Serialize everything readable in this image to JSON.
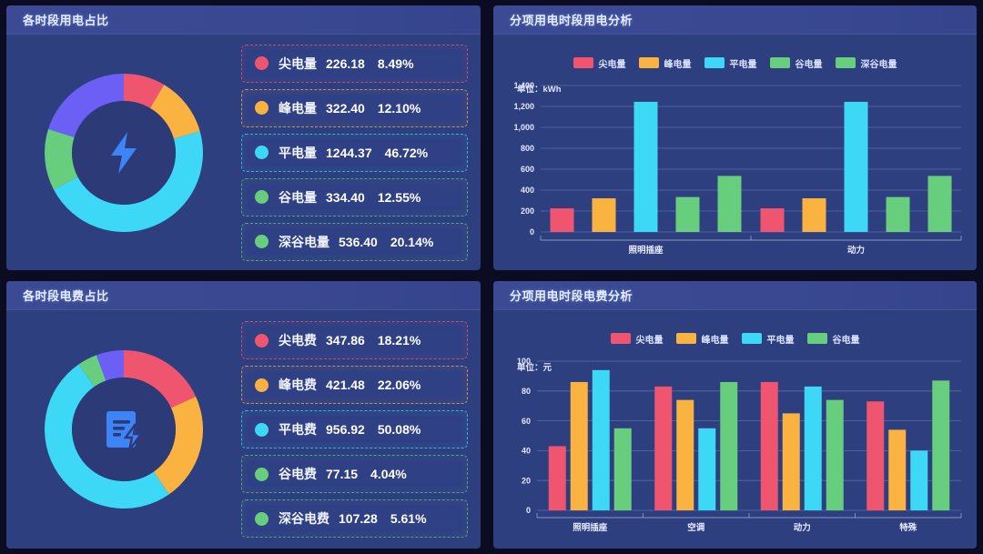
{
  "theme": {
    "background": "#0b0c22",
    "panel_bg": "#2e3f80",
    "header_bg": "#3a4991",
    "title_color": "#e8ecff"
  },
  "series_colors": {
    "jian": "#f0556f",
    "feng": "#fab240",
    "ping": "#3cd8f5",
    "gu": "#66ce7c",
    "shengu": "#6c5ff6",
    "shengu_legend": "#66ce7c"
  },
  "panels": {
    "usage_share": {
      "title": "各时段用电占比",
      "center_icon": "lightning-bolt-icon",
      "legend": [
        {
          "name": "尖电量",
          "value": "226.18",
          "percent": "8.49%",
          "pct_num": 8.49,
          "color": "#f0556f",
          "dot": "#f0556f"
        },
        {
          "name": "峰电量",
          "value": "322.40",
          "percent": "12.10%",
          "pct_num": 12.1,
          "color": "#fab240",
          "dot": "#fab240"
        },
        {
          "name": "平电量",
          "value": "1244.37",
          "percent": "46.72%",
          "pct_num": 46.72,
          "color": "#3cd8f5",
          "dot": "#3cd8f5"
        },
        {
          "name": "谷电量",
          "value": "334.40",
          "percent": "12.55%",
          "pct_num": 12.55,
          "color": "#66ce7c",
          "dot": "#66ce7c"
        },
        {
          "name": "深谷电量",
          "value": "536.40",
          "percent": "20.14%",
          "pct_num": 20.14,
          "color": "#6c5ff6",
          "dot": "#66ce7c"
        }
      ]
    },
    "cost_share": {
      "title": "各时段电费占比",
      "center_icon": "bill-lightning-icon",
      "legend": [
        {
          "name": "尖电费",
          "value": "347.86",
          "percent": "18.21%",
          "pct_num": 18.21,
          "color": "#f0556f",
          "dot": "#f0556f"
        },
        {
          "name": "峰电费",
          "value": "421.48",
          "percent": "22.06%",
          "pct_num": 22.06,
          "color": "#fab240",
          "dot": "#fab240"
        },
        {
          "name": "平电费",
          "value": "956.92",
          "percent": "50.08%",
          "pct_num": 50.08,
          "color": "#3cd8f5",
          "dot": "#3cd8f5"
        },
        {
          "name": "谷电费",
          "value": "77.15",
          "percent": "4.04%",
          "pct_num": 4.04,
          "color": "#66ce7c",
          "dot": "#66ce7c"
        },
        {
          "name": "深谷电费",
          "value": "107.28",
          "percent": "5.61%",
          "pct_num": 5.61,
          "color": "#6c5ff6",
          "dot": "#66ce7c"
        }
      ]
    },
    "usage_by_item": {
      "title": "分项用电时段用电分析"
    },
    "cost_by_item": {
      "title": "分项用电时段电费分析"
    }
  },
  "chart_data": [
    {
      "id": "usage_by_item",
      "type": "bar",
      "title": "分项用电时段用电分析",
      "unit_label": "单位：kWh",
      "ylabel": "kWh",
      "xlabel": "",
      "categories": [
        "照明插座",
        "动力"
      ],
      "series": [
        {
          "name": "尖电量",
          "color": "#f0556f",
          "values": [
            226,
            226
          ]
        },
        {
          "name": "峰电量",
          "color": "#fab240",
          "values": [
            322,
            322
          ]
        },
        {
          "name": "平电量",
          "color": "#3cd8f5",
          "values": [
            1244,
            1244
          ]
        },
        {
          "name": "谷电量",
          "color": "#66ce7c",
          "values": [
            334,
            334
          ]
        },
        {
          "name": "深谷电量",
          "color": "#66ce7c",
          "values": [
            536,
            536
          ]
        }
      ],
      "ylim": [
        0,
        1400
      ],
      "yticks": [
        "0",
        "200",
        "400",
        "600",
        "800",
        "1,000",
        "1,200",
        "1,400"
      ],
      "grid": true,
      "legend_position": "top-center"
    },
    {
      "id": "cost_by_item",
      "type": "bar",
      "title": "分项用电时段电费分析",
      "unit_label": "单位：元",
      "ylabel": "元",
      "xlabel": "",
      "categories": [
        "照明插座",
        "空调",
        "动力",
        "特殊"
      ],
      "series": [
        {
          "name": "尖电量",
          "color": "#f0556f",
          "values": [
            43,
            83,
            86,
            73
          ]
        },
        {
          "name": "峰电量",
          "color": "#fab240",
          "values": [
            86,
            74,
            65,
            54
          ]
        },
        {
          "name": "平电量",
          "color": "#3cd8f5",
          "values": [
            94,
            55,
            83,
            40
          ]
        },
        {
          "name": "谷电量",
          "color": "#66ce7c",
          "values": [
            55,
            86,
            74,
            87
          ]
        }
      ],
      "ylim": [
        0,
        100
      ],
      "yticks": [
        "0",
        "20",
        "40",
        "60",
        "80",
        "100"
      ],
      "grid": true,
      "legend_position": "top-center"
    }
  ]
}
